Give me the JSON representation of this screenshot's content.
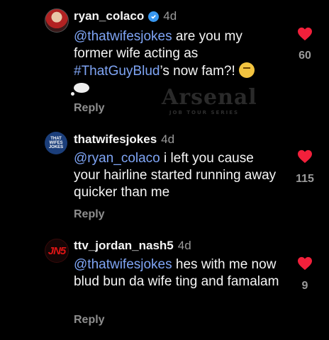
{
  "watermark": {
    "title": "Arsenal",
    "subtitle": "JOB TOUR SERIES"
  },
  "comments": [
    {
      "username": "ryan_colaco",
      "verified": true,
      "time": "4d",
      "mention": "@thatwifesjokes",
      "text_1": " are you my former wife acting as ",
      "hashtag": "#ThatGuyBlud",
      "text_2": "’s now fam?! ",
      "emoji": [
        "thinking-face",
        "thought-balloon"
      ],
      "reply_label": "Reply",
      "likes": "60",
      "liked": true
    },
    {
      "username": "thatwifesjokes",
      "avatar_text": "THAT WIFES JOKES",
      "time": "4d",
      "mention": "@ryan_colaco",
      "text_1": " i left you cause your hairline started running away quicker than me",
      "reply_label": "Reply",
      "likes": "115",
      "liked": true
    },
    {
      "username": "ttv_jordan_nash5",
      "avatar_text": "JN5",
      "time": "4d",
      "mention": "@thatwifesjokes",
      "text_1": " hes with me now blud bun da wife ting and famalam",
      "reply_label": "Reply",
      "likes": "9",
      "liked": true
    }
  ],
  "colors": {
    "background": "#000000",
    "mention": "#7fa5f5",
    "heart": "#f2203b",
    "verified": "#3897f0"
  }
}
